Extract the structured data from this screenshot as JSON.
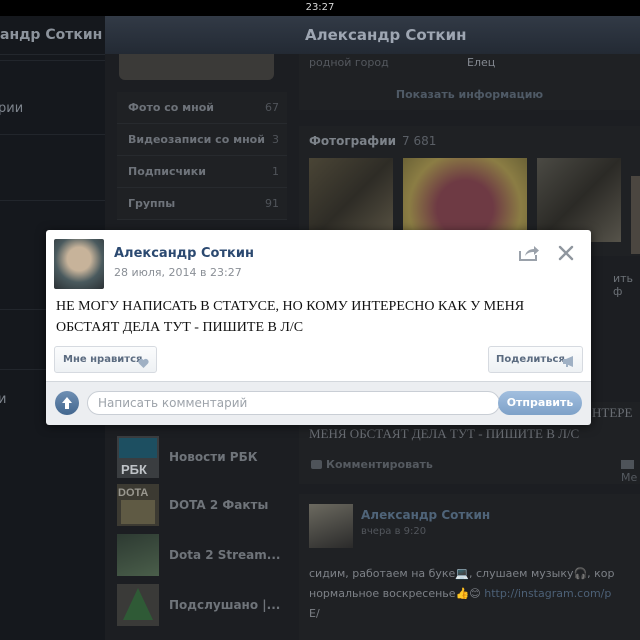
{
  "status_bar": {
    "time": "23:27"
  },
  "left_sidebar": {
    "header": "андр Соткин",
    "items": [
      "рии",
      "и"
    ]
  },
  "main_header": {
    "title": "Александр Соткин"
  },
  "profile_info": {
    "hometown_label": "родной город",
    "hometown_value": "Елец",
    "show_info_link": "Показать информацию"
  },
  "profile_menu": [
    {
      "label": "Фото со мной",
      "count": "67"
    },
    {
      "label": "Видеозаписи со мной",
      "count": "3"
    },
    {
      "label": "Подписчики",
      "count": "1"
    },
    {
      "label": "Группы",
      "count": "91"
    }
  ],
  "photos": {
    "title": "Фотографии",
    "count": "7 681"
  },
  "feed": [
    {
      "name": "Новости РБК",
      "icon": "rbc-logo-icon"
    },
    {
      "name": "DOTA 2 Факты",
      "icon": "dota-logo-icon"
    },
    {
      "name": "Dota 2 Stream...",
      "icon": "stream-avatar-icon"
    },
    {
      "name": "Подслушано |...",
      "icon": "tree-avatar-icon"
    }
  ],
  "bg_post": {
    "text_line1": "НТЕРЕ",
    "text_line2": "МЕНЯ ОБСТАЯТ ДЕЛА ТУТ - ПИШИТЕ В Л/С",
    "comment_label": "Комментировать",
    "more_label": "Ме"
  },
  "bg_post2": {
    "author": "Александр Соткин",
    "time": "вчера в 9:20",
    "text_line1": "сидим, работаем на буке💻, слушаем музыку🎧, кор",
    "text_line2": "нормальное воскресенье👍😊 ",
    "link": "http://instagram.com/p",
    "text_line3": "E/"
  },
  "right_clip": "ить ф",
  "modal": {
    "author": "Александр Соткин",
    "date": "28 июля, 2014 в 23:27",
    "text": "НЕ МОГУ НАПИСАТЬ В СТАТУСЕ, НО КОМУ ИНТЕРЕСНО КАК У МЕНЯ ОБСТАЯТ ДЕЛА ТУТ - ПИШИТЕ В Л/С",
    "like_label": "Мне нравится",
    "share_label": "Поделиться",
    "comment_placeholder": "Написать комментарий",
    "send_label": "Отправить"
  },
  "colors": {
    "accent": "#2b4970",
    "send_button": "#8eb0d6",
    "overlay_bg": "#1c1e22"
  }
}
